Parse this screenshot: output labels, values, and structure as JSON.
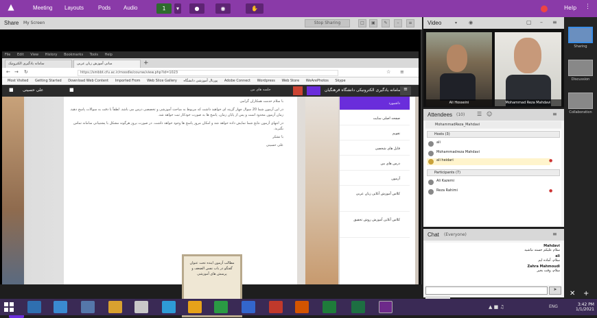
{
  "appbar": {
    "menus": [
      "Meeting",
      "Layouts",
      "Pods",
      "Audio"
    ],
    "help_label": "Help",
    "mic_count": "1"
  },
  "share": {
    "title": "Share",
    "sub": "My Screen",
    "stop_label": "Stop Sharing"
  },
  "browser": {
    "menubar": [
      "File",
      "Edit",
      "View",
      "History",
      "Bookmarks",
      "Tools",
      "Help"
    ],
    "tabs": [
      "سامانه یادگیری الکترونیک",
      "مبانی آموزش زبان عربی"
    ],
    "url": "https://smbbt.cfu.ac.ir/moodle/course/view.php?id=1023",
    "bookmarks": [
      "Most Visited",
      "Getting Started",
      "Download Web Content",
      "Imported From",
      "Web Slice Gallery",
      "پورتال آموزشی دانشگاه",
      "Adobe Connect",
      "Wordpress",
      "Web Store",
      "WeArePhotos",
      "Skype"
    ]
  },
  "moodle": {
    "user_name": "علی حسینی",
    "site_name": "سامانه یادگیری الکترونیکی دانشگاه فرهنگیان",
    "room_label": "جلسه های من",
    "content": {
      "heading": "با سلام خدمت همکاران گرامی",
      "paragraphs": [
        "در این آزمون شما 20 سوال چهار گزینه ای خواهید داشت که مربوط به مباحث آموزشی و تخصصی درس می باشد. لطفاً با دقت به سوالات پاسخ دهید. زمان آزمون محدود است و پس از پایان زمان، پاسخ ها به صورت خودکار ثبت خواهد شد.",
        "در انتهای آزمون نتایج شما نمایش داده خواهد شد و امکان مرور پاسخ ها وجود خواهد داشت. در صورت بروز هرگونه مشکل با پشتیبانی سامانه تماس بگیرید."
      ],
      "signoff": "با تشکر",
      "author": "علی حسینی"
    },
    "poster_text": "مطالب آزمون اینده تحت عنوان گفتگو در باب نفس الضعف و پرسش های آموزشی",
    "nav_items": [
      "داشبورد",
      "صفحه اصلی سایت",
      "تقویم",
      "فایل های شخصی",
      "درس های من",
      "آزمون",
      "کلاس آموزش آنلاین زبان عربی",
      "کلاس آنلاین آموزش روش تحقیق"
    ]
  },
  "video": {
    "title": "Video",
    "cams": [
      "Ali Hosseini",
      "Mohammad Reza Mahdavi"
    ]
  },
  "attendees": {
    "title": "Attendees",
    "count": "(10)",
    "host_name": "MohammadReza_Mahdavi",
    "hosts_group": "Hosts (3)",
    "hosts": [
      "ali",
      "Mohammadreza Mahdavi",
      "ali heidari"
    ],
    "participants_group": "Participants (7)",
    "participants": [
      "Ali Kazemi",
      "Reza Rahimi"
    ]
  },
  "chat": {
    "title": "Chat",
    "scope": "(Everyone)",
    "messages": [
      {
        "author": "Mahdavi",
        "text": "سلام علیکم خسته نباشید"
      },
      {
        "author": "ali",
        "text": "سلام، آماده ایم"
      },
      {
        "author": "Zahra Mahmoudi",
        "text": "سلام، وقت بخیر"
      }
    ],
    "tab_label": "Everyone"
  },
  "layouts": {
    "items": [
      "Sharing",
      "Discussion",
      "Collaboration"
    ]
  },
  "taskbar": {
    "time": "3:42 PM",
    "date": "1/1/2021",
    "lang": "ENG"
  },
  "colors": {
    "brand": "#8a3aa8",
    "moodle_accent": "#6a2ddb",
    "record": "#ee4444"
  }
}
